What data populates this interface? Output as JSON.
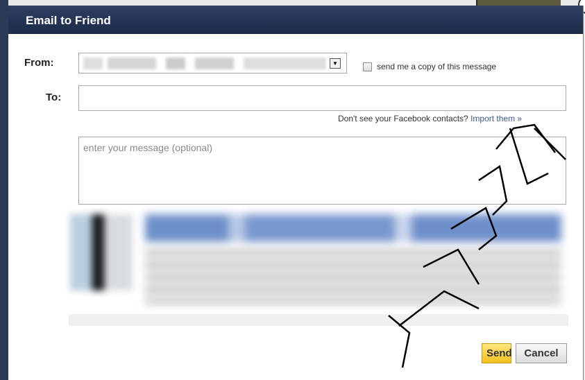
{
  "dialog": {
    "title": "Email to Friend"
  },
  "form": {
    "from_label": "From:",
    "to_label": "To:",
    "copy_label": "send me a copy of this message",
    "copy_checked": false,
    "contacts_question": "Don't see your Facebook contacts?",
    "import_link": "Import them »",
    "to_value": "",
    "message_placeholder": "enter your message (optional)",
    "message_value": ""
  },
  "buttons": {
    "send_label": "Send",
    "cancel_label": "Cancel"
  },
  "colors": {
    "titlebar": "#1d2b48",
    "link": "#3b5998",
    "send_button": "#f4c21c"
  },
  "icons": {
    "dropdown": "chevron-down-icon"
  }
}
